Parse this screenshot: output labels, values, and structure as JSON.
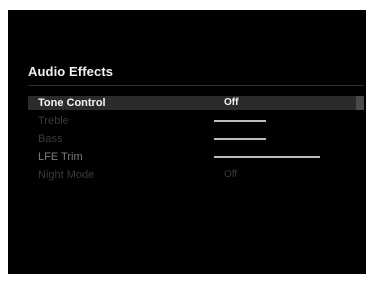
{
  "menu": {
    "title": "Audio Effects",
    "items": [
      {
        "label": "Tone Control",
        "value": "Off"
      },
      {
        "label": "Treble",
        "value": ""
      },
      {
        "label": "Bass",
        "value": ""
      },
      {
        "label": "LFE Trim",
        "value": ""
      },
      {
        "label": "Night Mode",
        "value": "Off"
      }
    ]
  }
}
